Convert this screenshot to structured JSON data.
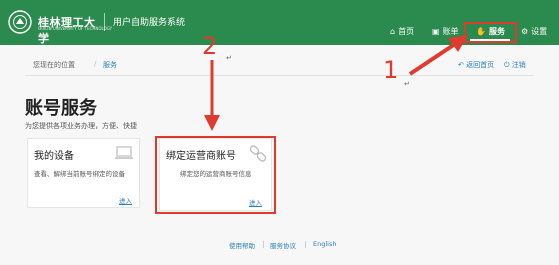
{
  "header": {
    "logo_text": "桂林理工大学",
    "logo_subtext": "GUILIN UNIVERSITY OF TECHNOLOGY",
    "system_name": "用户自助服务系统",
    "nav": [
      {
        "label": "首页",
        "icon": "home-icon"
      },
      {
        "label": "账单",
        "icon": "bill-icon"
      },
      {
        "label": "服务",
        "icon": "service-icon"
      },
      {
        "label": "设置",
        "icon": "gear-icon"
      }
    ]
  },
  "breadcrumb": {
    "location_label": "您现在的位置",
    "separator": "/",
    "current": "服务",
    "back_label": "返回首页",
    "logout_label": "注销"
  },
  "page": {
    "title": "账号服务",
    "subtitle": "为您提供各项业务办理，方便、快捷"
  },
  "cards": [
    {
      "title": "我的设备",
      "description": "查看、解绑当前账号绑定的设备",
      "link": "进入",
      "icon": "laptop-icon"
    },
    {
      "title": "绑定运营商账号",
      "description": "绑定您的运营商账号信息",
      "link": "进入",
      "icon": "chain-link-icon"
    }
  ],
  "annotations": {
    "step1": "1",
    "step2": "2",
    "mark": "↵",
    "color": "#e03a2f"
  },
  "footer": {
    "links": [
      "使用帮助",
      "服务协议",
      "English"
    ]
  },
  "colors": {
    "header_bg": "#2b8a4e",
    "link": "#2a7fc0",
    "annotation": "#e03a2f"
  }
}
